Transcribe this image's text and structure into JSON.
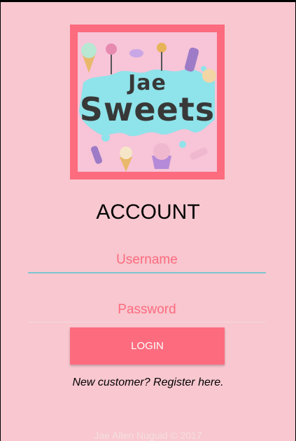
{
  "logo": {
    "line1": "Jae",
    "line2": "Sweets"
  },
  "page": {
    "title": "ACCOUNT"
  },
  "form": {
    "username_placeholder": "Username",
    "password_placeholder": "Password",
    "login_label": "LOGIN"
  },
  "register_link": "New customer? Register here.",
  "footer": "Jae Allen Nuguid © 2017",
  "colors": {
    "background": "#f8c7cf",
    "accent": "#fd6b7e",
    "input_underline": "#7ec5d0",
    "splash": "#8fe3ea"
  }
}
